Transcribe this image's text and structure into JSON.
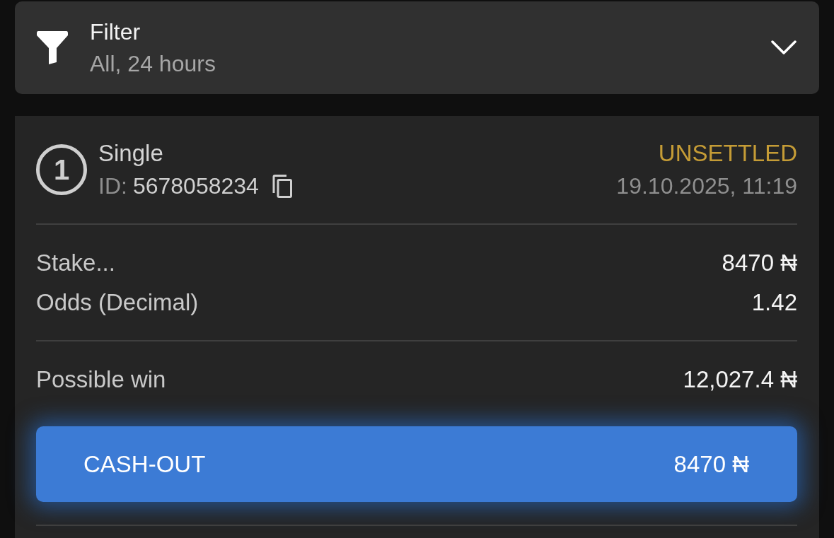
{
  "filter": {
    "title": "Filter",
    "summary": "All, 24 hours",
    "expanded": false
  },
  "bet": {
    "number": "1",
    "type": "Single",
    "id_label": "ID:",
    "id": "5678058234",
    "status": {
      "text": "UNSETTLED",
      "kind": "unsettled"
    },
    "datetime": "19.10.2025, 11:19",
    "details": [
      {
        "label": "Stake...",
        "value": "8470 ₦"
      },
      {
        "label": "Odds (Decimal)",
        "value": "1.42"
      }
    ],
    "possible_win": {
      "label": "Possible win",
      "value": "12,027.4 ₦"
    },
    "cashout": {
      "label": "CASH-OUT",
      "amount": "8470 ₦"
    }
  }
}
